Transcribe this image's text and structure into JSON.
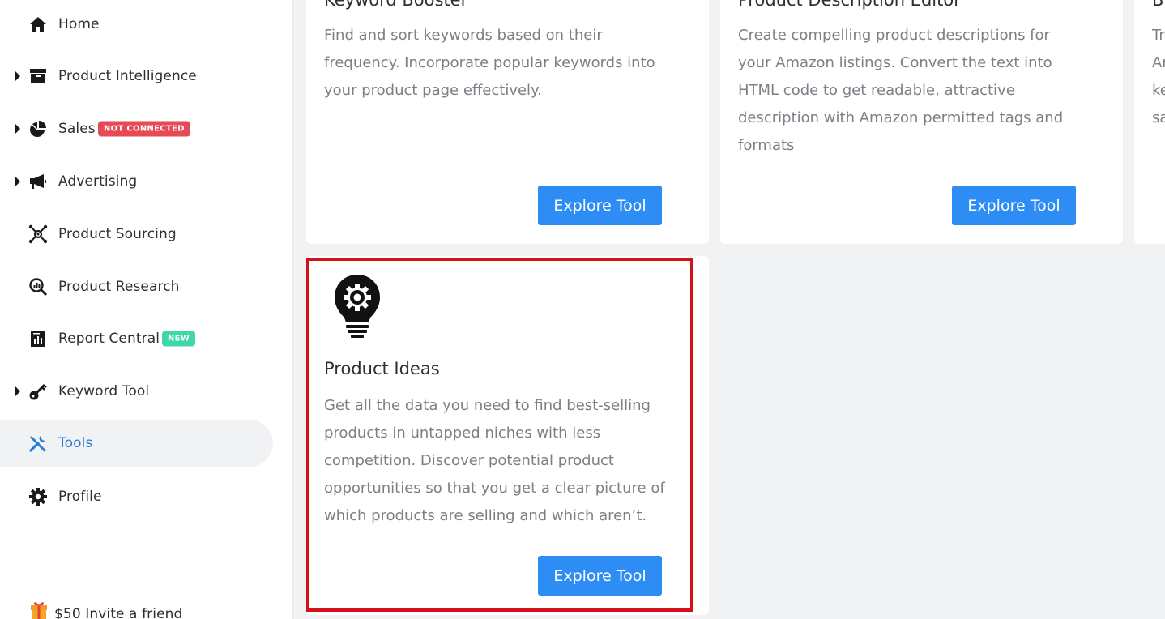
{
  "sidebar": {
    "items": [
      {
        "label": "Home",
        "icon": "home-icon"
      },
      {
        "label": "Product Intelligence",
        "icon": "archive-box-icon"
      },
      {
        "label": "Sales",
        "icon": "pie-chart-icon",
        "badge": "NOT CONNECTED"
      },
      {
        "label": "Advertising",
        "icon": "megaphone-icon"
      },
      {
        "label": "Product Sourcing",
        "icon": "network-nodes-icon"
      },
      {
        "label": "Product Research",
        "icon": "magnifier-chart-icon"
      },
      {
        "label": "Report Central",
        "icon": "report-document-icon",
        "badge": "NEW"
      },
      {
        "label": "Keyword Tool",
        "icon": "key-icon"
      },
      {
        "label": "Tools",
        "icon": "tools-icon",
        "active": true
      },
      {
        "label": "Profile",
        "icon": "gear-icon"
      }
    ],
    "invite": "$50 Invite a friend"
  },
  "cards": {
    "keyword_booster": {
      "title": "Keyword Booster",
      "description": "Find and sort keywords based on their frequency. Incorporate popular keywords into your product page effectively.",
      "button": "Explore Tool"
    },
    "product_description_editor": {
      "title": "Product Description Editor",
      "description": "Create compelling product descriptions for your Amazon listings. Convert the text into HTML code to get readable, attractive description with Amazon permitted tags and formats",
      "button": "Explore Tool"
    },
    "third_partial": {
      "title": "B",
      "lines": [
        "Tr",
        "Ar",
        "ke",
        "sa"
      ]
    },
    "product_ideas": {
      "title": "Product Ideas",
      "description": "Get all the data you need to find best-selling products in untapped niches with less competition. Discover potential product opportunities so that you get a clear picture of which products are selling and which aren’t.",
      "button": "Explore Tool",
      "icon": "lightbulb-gear-icon"
    }
  },
  "colors": {
    "accent": "#2e8cf5",
    "active_nav": "#2a7fd4",
    "highlight": "#d6101a",
    "badge_red": "#e64a55",
    "badge_green": "#3ed8a8"
  }
}
